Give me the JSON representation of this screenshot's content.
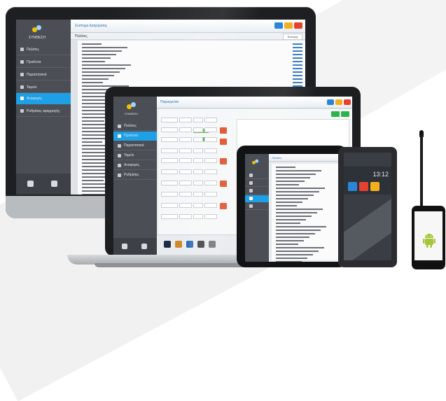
{
  "app": {
    "logo_text": "ΣΥΝΘΕΣΗ",
    "monitor": {
      "title": "Σύστημα Διαχείρισης",
      "list_header": "Πελάτες",
      "action_label": "Επιλογή",
      "nav": [
        "Πελάτες",
        "Προϊόντα",
        "Παραστατικά",
        "Ταμείο",
        "Αναφορές",
        "Ρυθμίσεις εφαρμογής"
      ]
    },
    "laptop": {
      "title": "Παραγγελία",
      "nav": [
        "Πελάτες",
        "Προϊόντα",
        "Παραστατικά",
        "Ταμείο",
        "Αναφορές",
        "Ρυθμίσεις"
      ]
    },
    "tablet": {
      "title": "Πελάτες"
    },
    "phablet": {
      "clock": "13:12"
    },
    "colors": {
      "accent": "#1ea0e6",
      "sidebar": "#4b4f55",
      "green": "#2eb34a",
      "red": "#e4412e",
      "yellow": "#f2b01e",
      "android_green": "#a4c639"
    },
    "icons": [
      "app-logo-icon",
      "phone-icon",
      "settings-icon",
      "close-icon",
      "minimize-icon",
      "maximize-icon",
      "android-icon"
    ]
  }
}
